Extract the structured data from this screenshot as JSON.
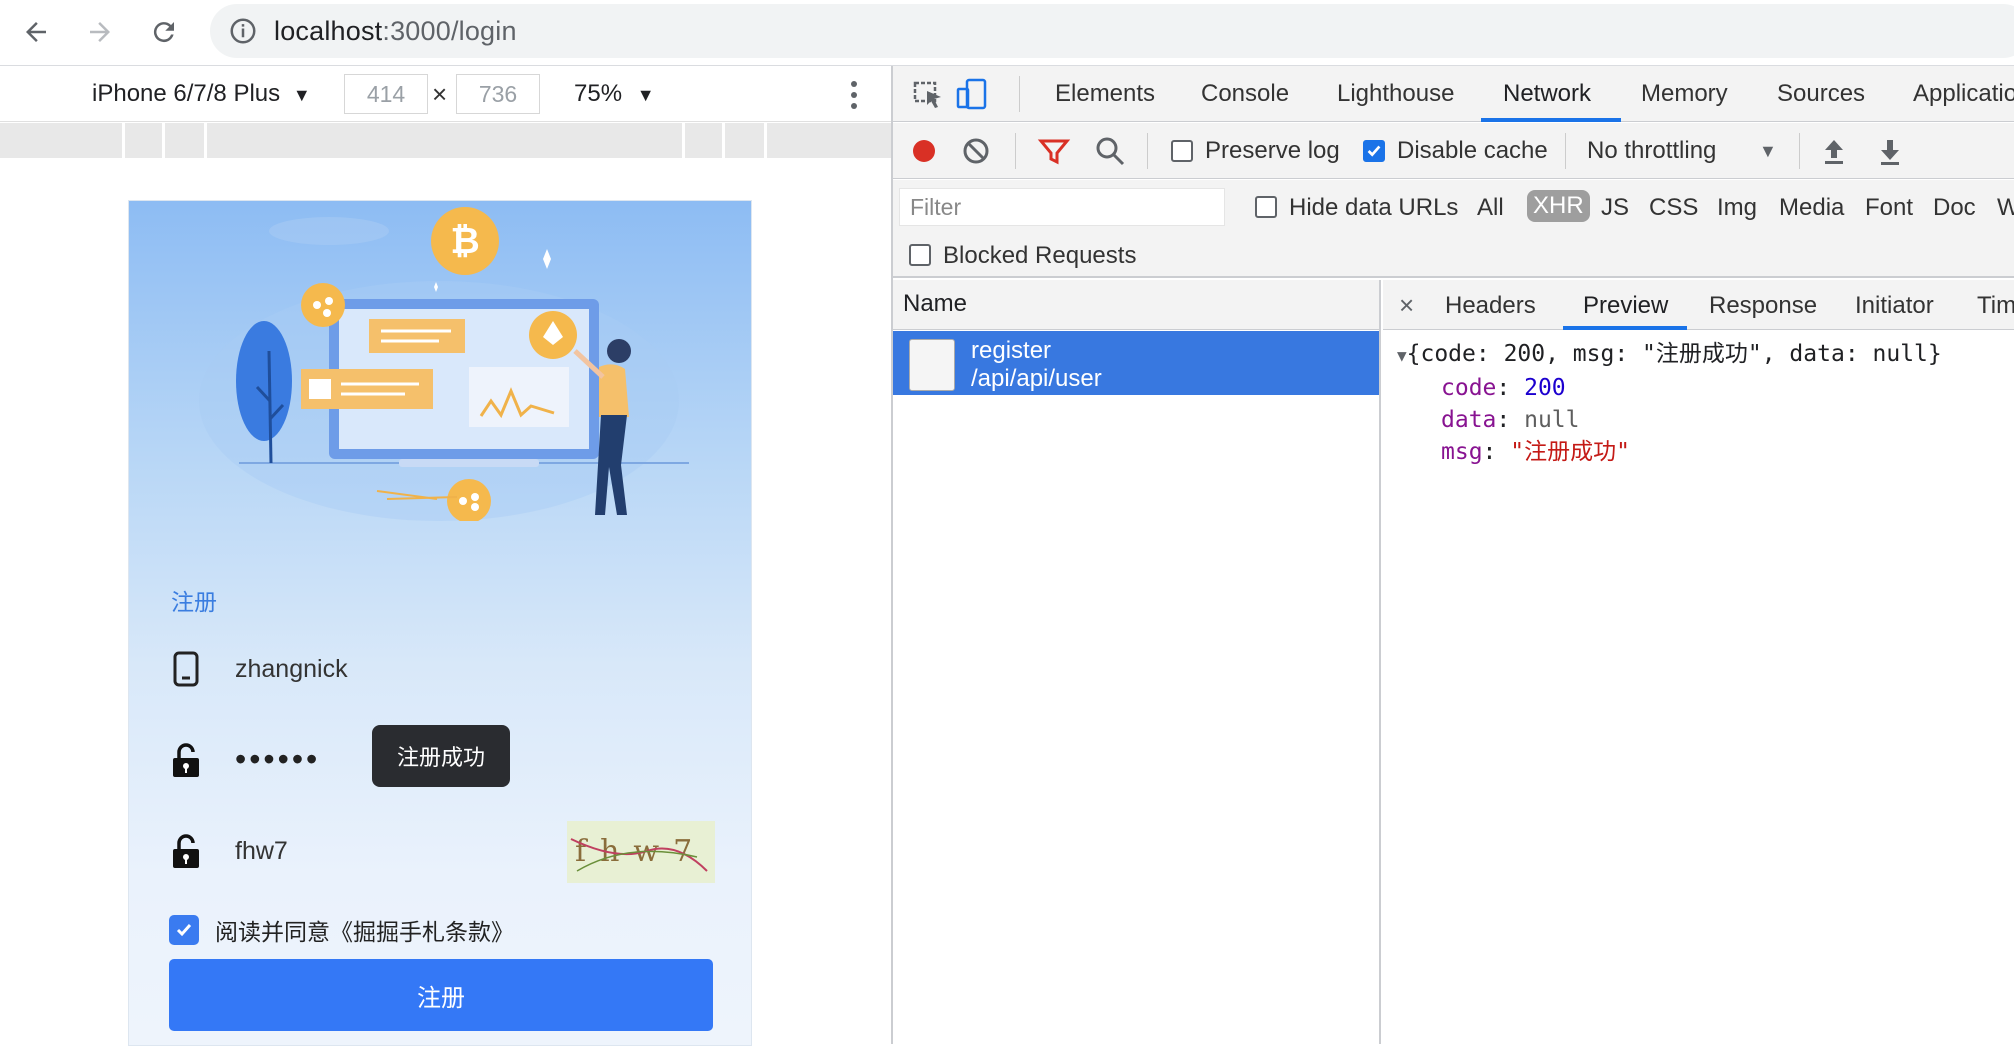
{
  "browser": {
    "url_host": "localhost",
    "url_path": ":3000/login"
  },
  "device_toolbar": {
    "device": "iPhone 6/7/8 Plus",
    "width": "414",
    "height": "736",
    "zoom": "75%"
  },
  "phone": {
    "form_title": "注册",
    "username": "zhangnick",
    "password_mask": "••••••",
    "toast": "注册成功",
    "captcha_input": "fhw7",
    "captcha_text": "fhw7",
    "agree_text": "阅读并同意《掘掘手札条款》",
    "submit_label": "注册"
  },
  "devtools": {
    "tabs": [
      "Elements",
      "Console",
      "Lighthouse",
      "Network",
      "Memory",
      "Sources",
      "Applicatio"
    ],
    "active_tab": "Network",
    "toolbar": {
      "preserve_log": "Preserve log",
      "disable_cache": "Disable cache",
      "throttling": "No throttling"
    },
    "filter": {
      "placeholder": "Filter",
      "hide_data_urls": "Hide data URLs",
      "types": [
        "All",
        "XHR",
        "JS",
        "CSS",
        "Img",
        "Media",
        "Font",
        "Doc",
        "W"
      ],
      "active_type": "XHR",
      "blocked_requests": "Blocked Requests"
    },
    "name_header": "Name",
    "request": {
      "name": "register",
      "path": "/api/api/user"
    },
    "detail_tabs": [
      "Headers",
      "Preview",
      "Response",
      "Initiator",
      "Timi"
    ],
    "active_detail_tab": "Preview",
    "preview": {
      "summary": "{code: 200, msg: \"注册成功\", data: null}",
      "code_key": "code",
      "code_val": "200",
      "data_key": "data",
      "data_val": "null",
      "msg_key": "msg",
      "msg_val": "\"注册成功\""
    }
  },
  "colors": {
    "accent": "#1a73e8",
    "selected_row": "#3878e0",
    "submit": "#3478f6",
    "record": "#d93025"
  }
}
